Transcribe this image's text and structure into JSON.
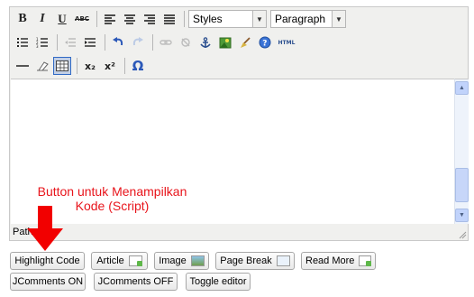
{
  "toolbar": {
    "styles_select": "Styles",
    "format_select": "Paragraph",
    "html_label": "HTML",
    "bold_glyph": "B",
    "italic_glyph": "I",
    "underline_glyph": "U",
    "strike_glyph": "ABC",
    "sub_glyph": "x₂",
    "sup_glyph": "x²",
    "charmap_glyph": "Ω"
  },
  "editor": {
    "path_label": "Path:"
  },
  "annotation": {
    "line1": "Button untuk Menampilkan",
    "line2": "Kode (Script)",
    "color": "#e8141b"
  },
  "buttons": {
    "highlight_code": "Highlight Code",
    "article": "Article",
    "image": "Image",
    "page_break": "Page Break",
    "read_more": "Read More",
    "jcomments_on": "JComments ON",
    "jcomments_off": "JComments OFF",
    "toggle_editor": "Toggle editor"
  }
}
